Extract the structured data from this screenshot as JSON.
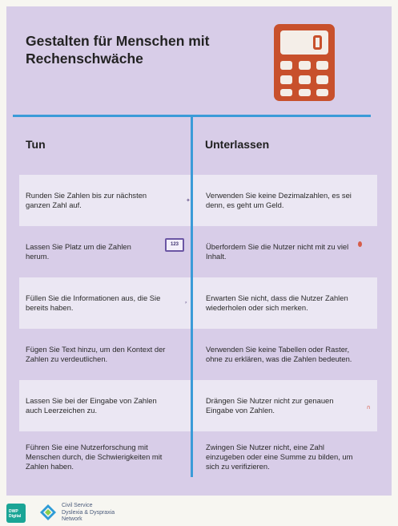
{
  "title": "Gestalten für Menschen mit Rechenschwäche",
  "icon": "calculator-icon",
  "colors": {
    "background": "#d8cde8",
    "row_shade": "#ebe7f3",
    "divider": "#3b9bd8",
    "calculator": "#c8502c"
  },
  "headers": {
    "do": "Tun",
    "dont": "Unterlassen"
  },
  "rows": [
    {
      "do": "Runden Sie Zahlen bis zur nächsten ganzen Zahl auf.",
      "dont": "Verwenden Sie keine Dezimalzahlen, es sei denn, es geht um Geld."
    },
    {
      "do": "Lassen Sie Platz um die Zahlen herum.",
      "dont": "Überfordern Sie die Nutzer nicht mit zu viel Inhalt."
    },
    {
      "do": "Füllen Sie die Informationen aus, die Sie bereits haben.",
      "dont": "Erwarten Sie nicht, dass die Nutzer Zahlen wiederholen oder sich merken."
    },
    {
      "do": "Fügen Sie Text hinzu, um den Kontext der Zahlen zu verdeutlichen.",
      "dont": "Verwenden Sie keine Tabellen oder Raster, ohne zu erklären, was die Zahlen bedeuten."
    },
    {
      "do": "Lassen Sie bei der Eingabe von Zahlen auch Leerzeichen zu.",
      "dont": "Drängen Sie Nutzer nicht zur genauen Eingabe von Zahlen."
    },
    {
      "do": "Führen Sie eine Nutzerforschung mit Menschen durch, die Schwierigkeiten mit Zahlen haben.",
      "dont": "Zwingen Sie Nutzer nicht, eine Zahl einzugeben oder eine Summe zu bilden, um sich zu verifizieren."
    }
  ],
  "illustration": {
    "number_box": "123"
  },
  "footer": {
    "dwp_logo": "DWP Digital",
    "network_line1": "Civil Service",
    "network_line2": "Dyslexia & Dyspraxia",
    "network_line3": "Network"
  }
}
